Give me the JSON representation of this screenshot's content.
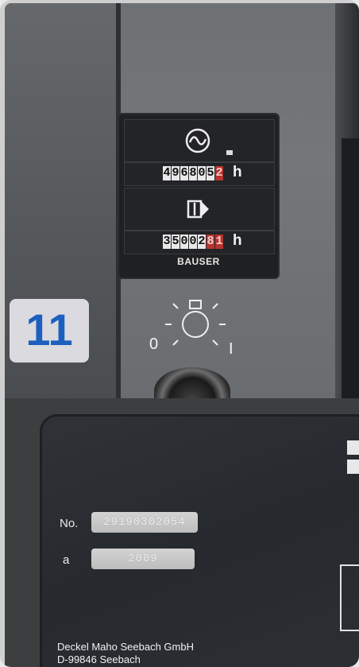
{
  "badge": {
    "number": "11"
  },
  "hour_meter": {
    "counter1_digits": [
      "4",
      "9",
      "6",
      "8",
      "0",
      "5",
      "2"
    ],
    "counter1_unit": "h",
    "counter2_digits": [
      "3",
      "5",
      "0",
      "0",
      "2",
      "8",
      "1"
    ],
    "counter2_unit": "h",
    "brand": "BAUSER"
  },
  "switch": {
    "off_label": "0",
    "on_label": "I"
  },
  "nameplate": {
    "no_label": "No.",
    "no_value": "29190302054",
    "a_label": "a",
    "a_value": "2009",
    "maker_line1": "Deckel Maho Seebach GmbH",
    "maker_line2": "D-99846 Seebach"
  }
}
